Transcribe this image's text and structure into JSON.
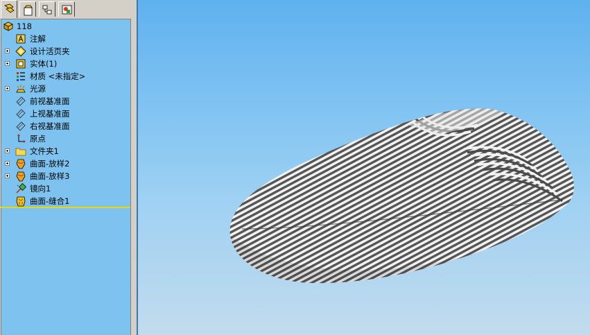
{
  "feature_manager": {
    "tabs": [
      {
        "name": "featuremanager-tab",
        "icon": "feature-tree-icon"
      },
      {
        "name": "propertymanager-tab",
        "icon": "property-icon"
      },
      {
        "name": "configurationmanager-tab",
        "icon": "configuration-icon"
      },
      {
        "name": "displaymanager-tab",
        "icon": "display-icon"
      }
    ],
    "root": {
      "label": "118",
      "icon": "part-icon"
    },
    "items": [
      {
        "label": "注解",
        "icon": "annotation-icon",
        "expandable": false
      },
      {
        "label": "设计活页夹",
        "icon": "design-binder-icon",
        "expandable": true
      },
      {
        "label": "实体(1)",
        "icon": "solid-bodies-icon",
        "expandable": true
      },
      {
        "label": "材质 <未指定>",
        "icon": "material-icon",
        "expandable": false
      },
      {
        "label": "光源",
        "icon": "lights-icon",
        "expandable": true
      },
      {
        "label": "前视基准面",
        "icon": "plane-icon",
        "expandable": false
      },
      {
        "label": "上视基准面",
        "icon": "plane-icon",
        "expandable": false
      },
      {
        "label": "右视基准面",
        "icon": "plane-icon",
        "expandable": false
      },
      {
        "label": "原点",
        "icon": "origin-icon",
        "expandable": false
      },
      {
        "label": "文件夹1",
        "icon": "folder-icon",
        "expandable": true
      },
      {
        "label": "曲面-放样2",
        "icon": "surface-loft-icon",
        "expandable": true
      },
      {
        "label": "曲面-放样3",
        "icon": "surface-loft-icon",
        "expandable": true
      },
      {
        "label": "镜向1",
        "icon": "mirror-icon",
        "expandable": false
      },
      {
        "label": "曲面-缝合1",
        "icon": "surface-knit-icon",
        "expandable": false
      }
    ]
  },
  "colors": {
    "tree_bg": "#7ec2f0",
    "rollback_bar": "#e8d800",
    "viewport_top": "#5fb1ef",
    "viewport_bottom": "#c2dbee"
  }
}
